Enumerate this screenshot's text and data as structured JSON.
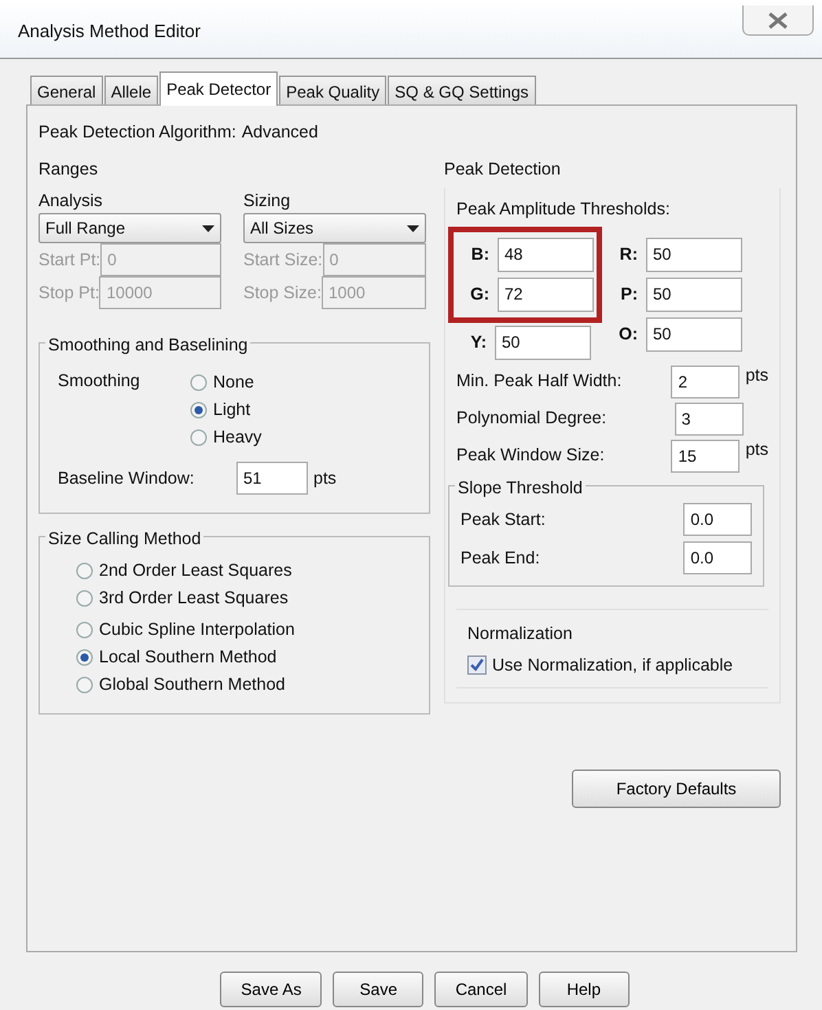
{
  "window": {
    "title": "Analysis Method Editor"
  },
  "tabs": [
    {
      "label": "General",
      "selected": false
    },
    {
      "label": "Allele",
      "selected": false
    },
    {
      "label": "Peak Detector",
      "selected": true
    },
    {
      "label": "Peak Quality",
      "selected": false
    },
    {
      "label": "SQ & GQ Settings",
      "selected": false
    }
  ],
  "algorithm": {
    "label": "Peak Detection Algorithm:",
    "value": "Advanced"
  },
  "ranges": {
    "title": "Ranges",
    "columns": [
      {
        "heading": "Analysis",
        "dropdown": "Full Range",
        "fields": [
          {
            "label": "Start Pt:",
            "value": "0",
            "disabled": true
          },
          {
            "label": "Stop Pt:",
            "value": "10000",
            "disabled": true
          }
        ]
      },
      {
        "heading": "Sizing",
        "dropdown": "All Sizes",
        "fields": [
          {
            "label": "Start Size:",
            "value": "0",
            "disabled": true
          },
          {
            "label": "Stop Size:",
            "value": "1000",
            "disabled": true
          }
        ]
      }
    ]
  },
  "smoothing": {
    "title": "Smoothing and Baselining",
    "label": "Smoothing",
    "options": [
      {
        "label": "None",
        "selected": false
      },
      {
        "label": "Light",
        "selected": true
      },
      {
        "label": "Heavy",
        "selected": false
      }
    ],
    "baseline": {
      "label": "Baseline Window:",
      "value": "51",
      "unit": "pts"
    }
  },
  "size_calling": {
    "title": "Size Calling Method",
    "options": [
      {
        "label": "2nd Order Least Squares",
        "selected": false
      },
      {
        "label": "3rd Order Least Squares",
        "selected": false
      },
      {
        "label": "Cubic Spline Interpolation",
        "selected": false
      },
      {
        "label": "Local Southern Method",
        "selected": true
      },
      {
        "label": "Global Southern Method",
        "selected": false
      }
    ]
  },
  "peak_detection": {
    "title": "Peak Detection",
    "thresholds_label": "Peak Amplitude Thresholds:",
    "thresholds": [
      {
        "left": {
          "label": "B:",
          "value": "48"
        },
        "right": {
          "label": "R:",
          "value": "50"
        },
        "highlighted": true
      },
      {
        "left": {
          "label": "G:",
          "value": "72"
        },
        "right": {
          "label": "P:",
          "value": "50"
        },
        "highlighted": true
      },
      {
        "left": {
          "label": "Y:",
          "value": "50"
        },
        "right": {
          "label": "O:",
          "value": "50"
        },
        "highlighted": false
      }
    ],
    "params": [
      {
        "label": "Min. Peak Half Width:",
        "value": "2",
        "unit": "pts"
      },
      {
        "label": "Polynomial Degree:",
        "value": "3"
      },
      {
        "label": "Peak Window Size:",
        "value": "15",
        "unit": "pts"
      }
    ],
    "slope": {
      "title": "Slope Threshold",
      "fields": [
        {
          "label": "Peak Start:",
          "value": "0.0"
        },
        {
          "label": "Peak End:",
          "value": "0.0"
        }
      ]
    }
  },
  "normalization": {
    "title": "Normalization",
    "checkbox": {
      "label": "Use Normalization, if applicable",
      "checked": true
    }
  },
  "factory_button": "Factory Defaults",
  "buttons": [
    "Save As",
    "Save",
    "Cancel",
    "Help"
  ]
}
